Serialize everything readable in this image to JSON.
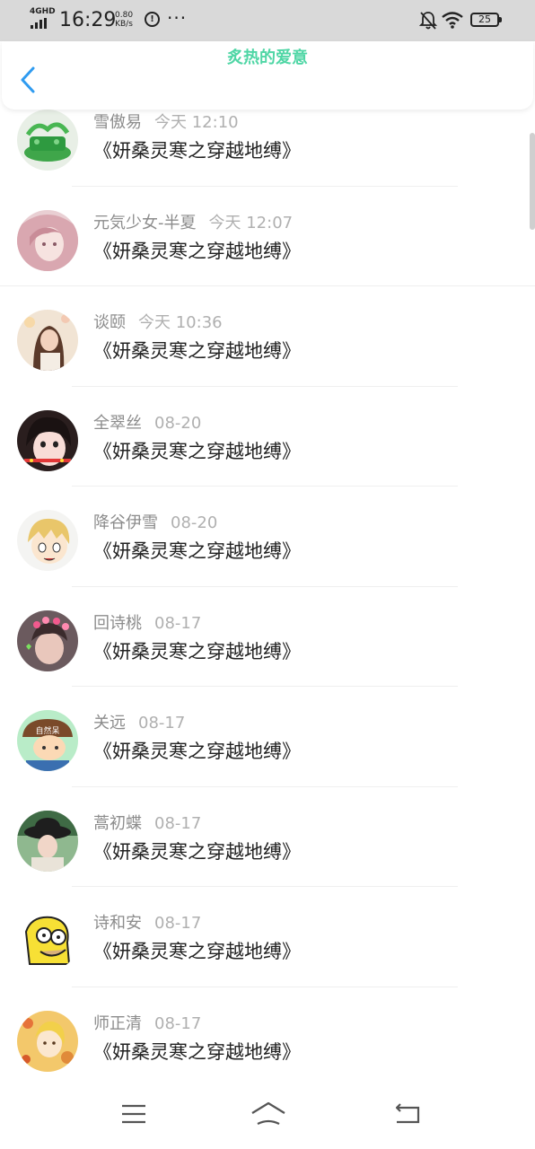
{
  "status_bar": {
    "network": "4GHD",
    "time": "16:29",
    "speed_value": "0.80",
    "speed_unit": "KB/s",
    "circle_icon_label": "!",
    "more": "···",
    "battery": "25"
  },
  "header": {
    "title": "炙热的爱意",
    "title_color": "#4fd6a5",
    "back_icon": "chevron-left-icon",
    "back_color": "#2f9bf0"
  },
  "list": [
    {
      "name": "雪傲易",
      "time": "今天 12:10",
      "book": "《妍桑灵寒之穿越地缚》",
      "avatar": "jade-dragon-avatar"
    },
    {
      "name": "元気少女-半夏",
      "time": "今天 12:07",
      "book": "《妍桑灵寒之穿越地缚》",
      "avatar": "pink-anime-girl-avatar"
    },
    {
      "name": "谈颐",
      "time": "今天 10:36",
      "book": "《妍桑灵寒之穿越地缚》",
      "avatar": "girl-photo-avatar"
    },
    {
      "name": "全翠丝",
      "time": "08-20",
      "book": "《妍桑灵寒之穿越地缚》",
      "avatar": "girl-bangs-avatar"
    },
    {
      "name": "降谷伊雪",
      "time": "08-20",
      "book": "《妍桑灵寒之穿越地缚》",
      "avatar": "anime-blonde-boy-avatar"
    },
    {
      "name": "回诗桃",
      "time": "08-17",
      "book": "《妍桑灵寒之穿越地缚》",
      "avatar": "flower-crown-avatar"
    },
    {
      "name": "关远",
      "time": "08-17",
      "book": "《妍桑灵寒之穿越地缚》",
      "avatar": "cartoon-boy-avatar",
      "avatar_text": "自然呆"
    },
    {
      "name": "蒿初蝶",
      "time": "08-17",
      "book": "《妍桑灵寒之穿越地缚》",
      "avatar": "girl-hat-avatar"
    },
    {
      "name": "诗和安",
      "time": "08-17",
      "book": "《妍桑灵寒之穿越地缚》",
      "avatar": "simpson-avatar"
    },
    {
      "name": "师正清",
      "time": "08-17",
      "book": "《妍桑灵寒之穿越地缚》",
      "avatar": "anime-autumn-avatar"
    }
  ],
  "bottom_nav": {
    "menu_icon": "menu-icon",
    "home_icon": "home-icon",
    "back_icon": "back-icon"
  }
}
